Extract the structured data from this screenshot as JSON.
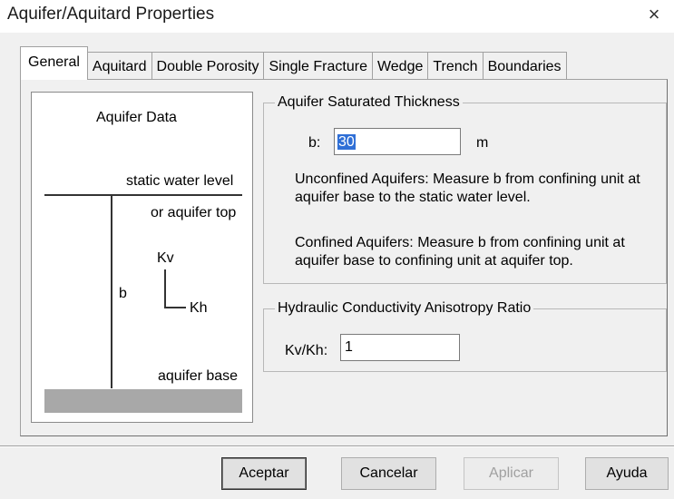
{
  "window": {
    "title": "Aquifer/Aquitard Properties",
    "close_glyph": "×"
  },
  "tabs": [
    {
      "label": "General",
      "active": true
    },
    {
      "label": "Aquitard"
    },
    {
      "label": "Double Porosity"
    },
    {
      "label": "Single Fracture"
    },
    {
      "label": "Wedge"
    },
    {
      "label": "Trench"
    },
    {
      "label": "Boundaries"
    }
  ],
  "diagram": {
    "heading": "Aquifer Data",
    "static_label": "static water level",
    "top_label": "or aquifer top",
    "kv_label": "Kv",
    "b_label": "b",
    "kh_label": "Kh",
    "base_label": "aquifer base"
  },
  "thickness_group": {
    "legend": "Aquifer Saturated Thickness",
    "b_label": "b:",
    "b_value": "30",
    "unit": "m",
    "unconfined_text": "Unconfined Aquifers:  Measure b from confining unit at aquifer base to the static water level.",
    "confined_text": "Confined Aquifers:  Measure b from confining unit at aquifer base to confining unit at aquifer top."
  },
  "anisotropy_group": {
    "legend": "Hydraulic Conductivity Anisotropy Ratio",
    "ratio_label": "Kv/Kh:",
    "ratio_value": "1"
  },
  "buttons": {
    "accept": "Aceptar",
    "cancel": "Cancelar",
    "apply": "Aplicar",
    "help": "Ayuda"
  }
}
